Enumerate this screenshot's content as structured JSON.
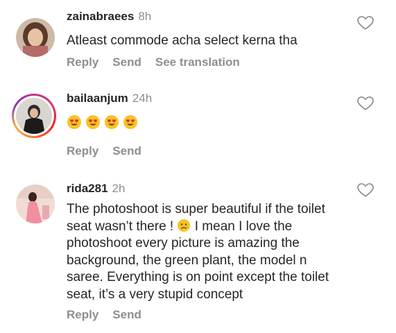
{
  "comments": [
    {
      "username": "zainabraees",
      "time": "8h",
      "text": "Atleast commode acha select kerna tha",
      "actions": {
        "reply": "Reply",
        "send": "Send",
        "translate": "See translation"
      }
    },
    {
      "username": "bailaanjum",
      "time": "24h",
      "emojis": [
        "heart-eyes-emoji",
        "heart-eyes-emoji",
        "heart-eyes-emoji",
        "heart-eyes-emoji"
      ],
      "actions": {
        "reply": "Reply",
        "send": "Send"
      }
    },
    {
      "username": "rida281",
      "time": "2h",
      "text_part1": "The photoshoot is super beautiful if the toilet seat wasn’t there ! ",
      "text_part2": " I mean I love the photoshoot every picture is amazing the background, the green plant, the model n saree. Everything is on point except the toilet seat, it’s a very stupid concept",
      "inline_emoji": "crying-face-emoji",
      "actions": {
        "reply": "Reply",
        "send": "Send"
      }
    }
  ],
  "colors": {
    "text": "#262626",
    "muted": "#8e8e8e",
    "story_ring": "#e1306c"
  }
}
